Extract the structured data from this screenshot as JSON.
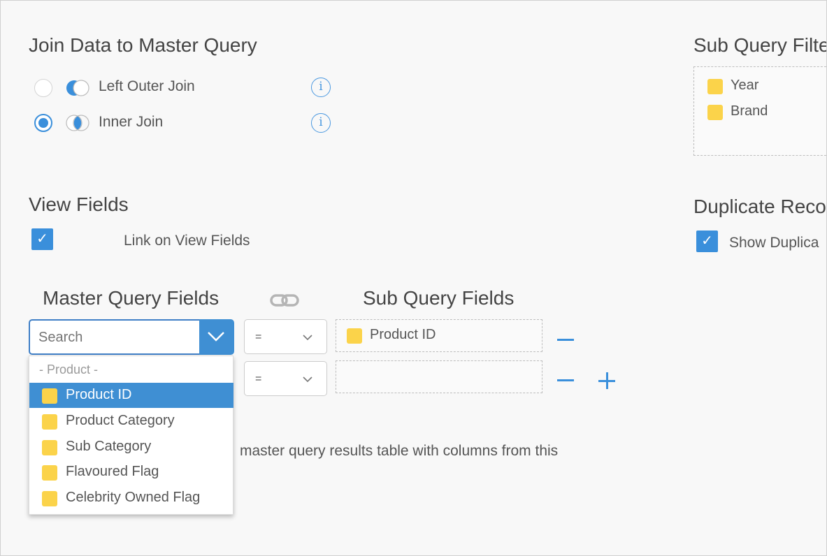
{
  "join": {
    "title": "Join Data to Master Query",
    "options": [
      {
        "label": "Left Outer Join",
        "selected": false,
        "info_icon": "info-icon"
      },
      {
        "label": "Inner Join",
        "selected": true,
        "info_icon": "info-icon"
      }
    ],
    "info_glyph": "i"
  },
  "sub_query_filter": {
    "title": "Sub Query Filte",
    "items": [
      "Year",
      "Brand"
    ]
  },
  "view_fields": {
    "title": "View Fields",
    "checkbox_label": "Link on View Fields",
    "checked": true
  },
  "duplicate_records": {
    "title": "Duplicate Reco",
    "checkbox_label": "Show Duplica",
    "checked": true
  },
  "field_mapping": {
    "master_title": "Master Query Fields",
    "sub_title": "Sub Query Fields",
    "link_icon": "link-chain-icon",
    "search_placeholder": "Search",
    "operators": [
      "=",
      "="
    ],
    "rows": [
      {
        "sub_field": "Product ID"
      },
      {
        "sub_field": ""
      }
    ]
  },
  "dropdown": {
    "group_label": "- Product -",
    "options": [
      "Product ID",
      "Product Category",
      "Sub Category",
      "Flavoured Flag",
      "Celebrity Owned Flag"
    ],
    "highlighted": "Product ID"
  },
  "background_text": "master query results table with columns from this",
  "colors": {
    "accent": "#3a8fdb",
    "field_yellow": "#fbd34a",
    "highlight": "#3f8fd3"
  }
}
